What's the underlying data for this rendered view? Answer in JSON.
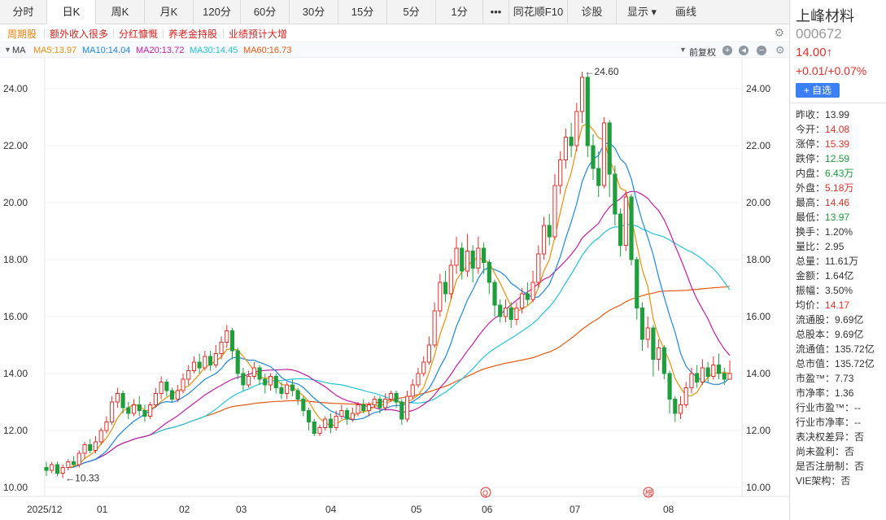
{
  "tabs": [
    "分时",
    "日K",
    "周K",
    "月K",
    "120分",
    "60分",
    "30分",
    "15分",
    "5分",
    "1分",
    "•••",
    "同花顺F10",
    "诊股",
    "显示",
    "画线"
  ],
  "active_tab": "日K",
  "tags": [
    "周期股",
    "额外收入很多",
    "分红慷慨",
    "养老金持股",
    "业绩预计大增"
  ],
  "ma_legend": {
    "label": "MA",
    "items": [
      {
        "text": "MA5:13.97",
        "color": "#e8900c"
      },
      {
        "text": "MA10:14.04",
        "color": "#1f86e0"
      },
      {
        "text": "MA20:13.72",
        "color": "#c41fa3"
      },
      {
        "text": "MA30:14.45",
        "color": "#23c5d8"
      },
      {
        "text": "MA60:16.73",
        "color": "#e85a12"
      }
    ],
    "adjust": "前复权"
  },
  "chart_data": {
    "type": "candlestick",
    "y_ticks": [
      "24.00",
      "22.00",
      "20.00",
      "18.00",
      "16.00",
      "14.00",
      "12.00",
      "10.00"
    ],
    "ylim": [
      10,
      25
    ],
    "x_labels": [
      "2025/12",
      "01",
      "02",
      "03",
      "04",
      "05",
      "06",
      "07",
      "08"
    ],
    "annotations": {
      "high": "←24.60",
      "low": "←10.33"
    },
    "markers": [
      "Q",
      "榜"
    ],
    "candles": [
      [
        10.7,
        10.6,
        10.9,
        10.4
      ],
      [
        10.6,
        10.8,
        10.9,
        10.5
      ],
      [
        10.8,
        10.5,
        10.9,
        10.4
      ],
      [
        10.5,
        10.7,
        10.8,
        10.33
      ],
      [
        10.7,
        10.9,
        11.0,
        10.6
      ],
      [
        10.9,
        10.8,
        11.1,
        10.7
      ],
      [
        10.8,
        11.2,
        11.3,
        10.7
      ],
      [
        11.2,
        11.5,
        11.6,
        11.0
      ],
      [
        11.5,
        11.3,
        11.7,
        11.2
      ],
      [
        11.3,
        11.6,
        11.8,
        11.2
      ],
      [
        11.6,
        12.0,
        12.1,
        11.5
      ],
      [
        12.0,
        12.3,
        12.5,
        11.9
      ],
      [
        12.3,
        13.0,
        13.2,
        12.2
      ],
      [
        13.0,
        13.3,
        13.5,
        12.8
      ],
      [
        13.3,
        12.8,
        13.4,
        12.6
      ],
      [
        12.8,
        12.6,
        13.0,
        12.4
      ],
      [
        12.6,
        12.9,
        13.1,
        12.5
      ],
      [
        12.9,
        12.7,
        13.2,
        12.5
      ],
      [
        12.7,
        12.5,
        12.9,
        12.3
      ],
      [
        12.5,
        12.9,
        13.0,
        12.4
      ],
      [
        12.9,
        13.3,
        13.5,
        12.8
      ],
      [
        13.3,
        13.7,
        13.9,
        13.1
      ],
      [
        13.7,
        13.4,
        13.8,
        13.2
      ],
      [
        13.4,
        13.1,
        13.5,
        13.0
      ],
      [
        13.1,
        13.4,
        13.6,
        13.0
      ],
      [
        13.4,
        13.8,
        14.0,
        13.3
      ],
      [
        13.8,
        14.1,
        14.3,
        13.6
      ],
      [
        14.1,
        14.4,
        14.6,
        14.0
      ],
      [
        14.4,
        14.2,
        14.7,
        14.0
      ],
      [
        14.2,
        14.6,
        14.8,
        14.1
      ],
      [
        14.6,
        14.3,
        14.8,
        14.1
      ],
      [
        14.3,
        14.7,
        15.0,
        14.2
      ],
      [
        14.7,
        15.1,
        15.3,
        14.5
      ],
      [
        15.1,
        15.5,
        15.7,
        14.9
      ],
      [
        15.5,
        14.8,
        15.6,
        14.5
      ],
      [
        14.8,
        14.0,
        14.9,
        13.8
      ],
      [
        14.0,
        13.6,
        14.2,
        13.4
      ],
      [
        13.6,
        13.9,
        14.1,
        13.5
      ],
      [
        13.9,
        14.2,
        14.4,
        13.8
      ],
      [
        14.2,
        13.8,
        14.3,
        13.6
      ],
      [
        13.8,
        13.6,
        14.0,
        13.3
      ],
      [
        13.6,
        13.9,
        14.0,
        13.4
      ],
      [
        13.9,
        13.5,
        14.0,
        13.3
      ],
      [
        13.5,
        13.3,
        13.7,
        13.1
      ],
      [
        13.3,
        13.6,
        13.7,
        13.1
      ],
      [
        13.6,
        13.4,
        13.8,
        13.2
      ],
      [
        13.4,
        13.1,
        13.5,
        12.9
      ],
      [
        13.1,
        12.7,
        13.2,
        12.5
      ],
      [
        12.7,
        12.3,
        12.8,
        12.0
      ],
      [
        12.3,
        11.9,
        12.4,
        11.8
      ],
      [
        11.9,
        12.1,
        12.2,
        11.8
      ],
      [
        12.1,
        12.4,
        12.5,
        12.0
      ],
      [
        12.4,
        12.1,
        12.6,
        11.9
      ],
      [
        12.1,
        12.5,
        12.7,
        12.0
      ],
      [
        12.5,
        12.7,
        12.9,
        12.4
      ],
      [
        12.7,
        12.4,
        12.8,
        12.2
      ],
      [
        12.4,
        12.6,
        12.8,
        12.3
      ],
      [
        12.6,
        12.9,
        13.0,
        12.5
      ],
      [
        12.9,
        12.7,
        13.1,
        12.6
      ],
      [
        12.7,
        12.9,
        13.0,
        12.5
      ],
      [
        12.9,
        13.1,
        13.2,
        12.8
      ],
      [
        13.1,
        12.8,
        13.2,
        12.6
      ],
      [
        12.8,
        13.1,
        13.3,
        12.7
      ],
      [
        13.1,
        13.3,
        13.4,
        13.0
      ],
      [
        13.3,
        13.0,
        13.4,
        12.8
      ],
      [
        13.0,
        12.4,
        13.1,
        12.2
      ],
      [
        12.4,
        13.2,
        13.4,
        12.3
      ],
      [
        13.2,
        13.6,
        13.8,
        13.1
      ],
      [
        13.6,
        14.0,
        14.2,
        13.5
      ],
      [
        14.0,
        14.4,
        14.6,
        13.9
      ],
      [
        14.4,
        15.0,
        15.3,
        14.3
      ],
      [
        15.0,
        16.2,
        16.5,
        14.9
      ],
      [
        16.2,
        17.2,
        17.5,
        16.0
      ],
      [
        17.2,
        16.8,
        17.6,
        16.5
      ],
      [
        16.8,
        17.8,
        18.0,
        16.6
      ],
      [
        17.8,
        18.4,
        18.8,
        17.5
      ],
      [
        18.4,
        17.6,
        18.6,
        17.3
      ],
      [
        17.6,
        18.3,
        18.9,
        17.4
      ],
      [
        18.3,
        17.7,
        18.5,
        17.2
      ],
      [
        17.7,
        18.4,
        18.8,
        17.5
      ],
      [
        18.4,
        17.9,
        18.6,
        17.5
      ],
      [
        17.9,
        17.2,
        18.0,
        16.8
      ],
      [
        17.2,
        16.4,
        17.3,
        16.0
      ],
      [
        16.4,
        16.0,
        16.6,
        15.8
      ],
      [
        16.0,
        16.3,
        16.6,
        15.8
      ],
      [
        16.3,
        15.9,
        16.5,
        15.6
      ],
      [
        15.9,
        16.3,
        16.5,
        15.7
      ],
      [
        16.3,
        16.8,
        17.0,
        16.1
      ],
      [
        16.8,
        16.6,
        17.2,
        16.4
      ],
      [
        16.6,
        17.2,
        17.6,
        16.5
      ],
      [
        17.2,
        18.2,
        18.5,
        17.0
      ],
      [
        18.2,
        19.2,
        19.5,
        18.0
      ],
      [
        19.2,
        18.8,
        19.6,
        18.5
      ],
      [
        18.8,
        20.6,
        21.0,
        18.7
      ],
      [
        20.6,
        21.5,
        21.8,
        20.3
      ],
      [
        21.5,
        22.3,
        22.6,
        21.2
      ],
      [
        22.3,
        22.0,
        22.8,
        21.6
      ],
      [
        22.0,
        23.2,
        23.5,
        21.8
      ],
      [
        23.2,
        24.4,
        24.6,
        22.8
      ],
      [
        24.4,
        22.0,
        24.5,
        21.6
      ],
      [
        22.0,
        21.2,
        22.4,
        20.8
      ],
      [
        21.2,
        20.6,
        21.8,
        20.2
      ],
      [
        20.6,
        22.8,
        23.0,
        20.5
      ],
      [
        22.8,
        21.0,
        22.9,
        20.2
      ],
      [
        21.0,
        19.6,
        21.3,
        19.2
      ],
      [
        19.6,
        18.5,
        19.8,
        18.1
      ],
      [
        18.5,
        20.2,
        20.4,
        18.3
      ],
      [
        20.2,
        18.0,
        20.3,
        17.8
      ],
      [
        18.0,
        16.3,
        18.1,
        15.9
      ],
      [
        16.3,
        15.2,
        16.5,
        14.8
      ],
      [
        15.2,
        15.6,
        16.0,
        14.9
      ],
      [
        15.6,
        14.5,
        15.7,
        13.9
      ],
      [
        14.5,
        14.9,
        15.2,
        14.1
      ],
      [
        14.9,
        14.0,
        15.0,
        13.8
      ],
      [
        14.0,
        13.1,
        14.1,
        12.6
      ],
      [
        13.1,
        12.6,
        13.2,
        12.3
      ],
      [
        12.6,
        12.9,
        13.2,
        12.4
      ],
      [
        12.9,
        13.5,
        13.7,
        12.8
      ],
      [
        13.5,
        14.0,
        14.2,
        13.3
      ],
      [
        14.0,
        13.7,
        14.3,
        13.5
      ],
      [
        13.7,
        14.2,
        14.5,
        13.6
      ],
      [
        14.2,
        13.9,
        14.4,
        13.7
      ],
      [
        13.9,
        14.3,
        14.6,
        13.8
      ],
      [
        14.3,
        14.0,
        14.7,
        13.8
      ],
      [
        14.0,
        13.8,
        14.2,
        13.6
      ],
      [
        13.8,
        14.0,
        14.46,
        13.97
      ]
    ]
  },
  "quote": {
    "name": "上峰材料",
    "code": "000672",
    "price": "14.00↑",
    "change": "+0.01/+0.07%",
    "add_watch": "+ 自选",
    "rows": [
      {
        "k": "昨收：",
        "v": "13.99",
        "c": "blk"
      },
      {
        "k": "今开：",
        "v": "14.08",
        "c": "red"
      },
      {
        "k": "涨停：",
        "v": "15.39",
        "c": "red"
      },
      {
        "k": "跌停：",
        "v": "12.59",
        "c": "green"
      },
      {
        "k": "内盘：",
        "v": "6.43万",
        "c": "green"
      },
      {
        "k": "外盘：",
        "v": "5.18万",
        "c": "red"
      },
      {
        "k": "最高：",
        "v": "14.46",
        "c": "red"
      },
      {
        "k": "最低：",
        "v": "13.97",
        "c": "green"
      },
      {
        "k": "换手：",
        "v": "1.20%",
        "c": "blk"
      },
      {
        "k": "量比：",
        "v": "2.95",
        "c": "blk"
      },
      {
        "k": "总量：",
        "v": "11.61万",
        "c": "blk"
      },
      {
        "k": "金额：",
        "v": "1.64亿",
        "c": "blk"
      },
      {
        "k": "振幅：",
        "v": "3.50%",
        "c": "blk"
      },
      {
        "k": "均价：",
        "v": "14.17",
        "c": "red"
      },
      {
        "k": "流通股：",
        "v": "9.69亿",
        "c": "blk"
      },
      {
        "k": "总股本：",
        "v": "9.69亿",
        "c": "blk"
      },
      {
        "k": "流通值：",
        "v": "135.72亿",
        "c": "blk"
      },
      {
        "k": "总市值：",
        "v": "135.72亿",
        "c": "blk"
      },
      {
        "k": "市盈™：",
        "v": "7.73",
        "c": "blk"
      },
      {
        "k": "市净率：",
        "v": "1.36",
        "c": "blk"
      },
      {
        "k": "行业市盈™：",
        "v": "--",
        "c": "blk"
      },
      {
        "k": "行业市净率：",
        "v": "--",
        "c": "blk"
      },
      {
        "k": "表决权差异：",
        "v": "否",
        "c": "blk"
      },
      {
        "k": "尚未盈利：",
        "v": "否",
        "c": "blk"
      },
      {
        "k": "是否注册制：",
        "v": "否",
        "c": "blk"
      },
      {
        "k": "VIE架构：",
        "v": "否",
        "c": "blk"
      }
    ]
  }
}
